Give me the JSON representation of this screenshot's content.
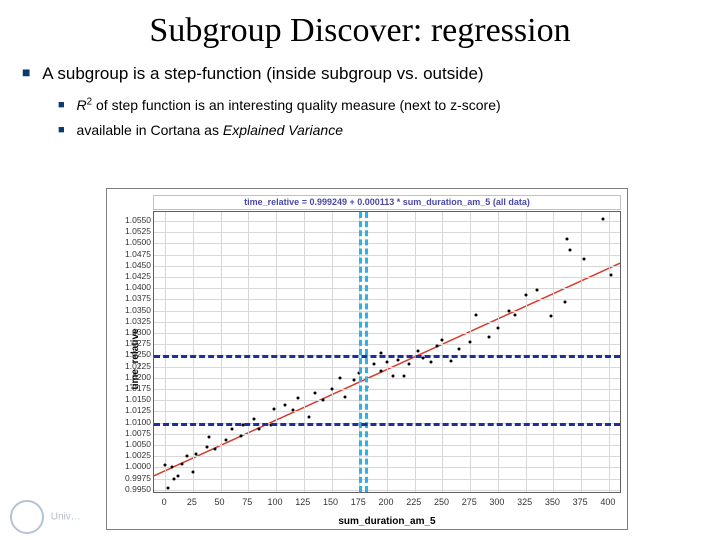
{
  "title": "Subgroup Discover: regression",
  "bullets": {
    "main": "A subgroup is a step-function (inside subgroup vs. outside)",
    "sub1": {
      "r": "R",
      "sup": "2",
      "rest": " of step function is an interesting quality measure (next to z-score)"
    },
    "sub2": {
      "pre": "available in Cortana as ",
      "ital": "Explained Variance"
    }
  },
  "footer": "Univ…",
  "chart_data": {
    "type": "scatter",
    "title": "time_relative = 0.999249 + 0.000113 * sum_duration_am_5 (all data)",
    "xlabel": "sum_duration_am_5",
    "ylabel": "time_relative",
    "xlim": [
      -10,
      410
    ],
    "ylim": [
      0.9945,
      1.057
    ],
    "xticks": [
      0,
      25,
      50,
      75,
      100,
      125,
      150,
      175,
      200,
      225,
      250,
      275,
      300,
      325,
      350,
      375,
      400
    ],
    "yticks": [
      0.995,
      0.9975,
      1.0,
      1.0025,
      1.005,
      1.0075,
      1.01,
      1.0125,
      1.015,
      1.0175,
      1.02,
      1.0225,
      1.025,
      1.0275,
      1.03,
      1.0325,
      1.035,
      1.0375,
      1.04,
      1.0425,
      1.045,
      1.0475,
      1.05,
      1.0525,
      1.055
    ],
    "regression": {
      "intercept": 0.999249,
      "slope": 0.000113
    },
    "v_dashes_x": [
      175,
      180
    ],
    "h_dashes_y": [
      1.01,
      1.025
    ],
    "points": [
      [
        3,
        0.9953
      ],
      [
        8,
        0.9975
      ],
      [
        0,
        1.0005
      ],
      [
        6,
        1.0
      ],
      [
        12,
        0.998
      ],
      [
        15,
        1.0008
      ],
      [
        20,
        1.0025
      ],
      [
        28,
        1.003
      ],
      [
        25,
        0.999
      ],
      [
        40,
        1.0068
      ],
      [
        38,
        1.0045
      ],
      [
        45,
        1.004
      ],
      [
        55,
        1.006
      ],
      [
        60,
        1.0085
      ],
      [
        70,
        1.0095
      ],
      [
        68,
        1.007
      ],
      [
        80,
        1.0108
      ],
      [
        85,
        1.0085
      ],
      [
        95,
        1.0095
      ],
      [
        98,
        1.013
      ],
      [
        108,
        1.014
      ],
      [
        115,
        1.0128
      ],
      [
        120,
        1.0155
      ],
      [
        130,
        1.0112
      ],
      [
        135,
        1.0165
      ],
      [
        142,
        1.015
      ],
      [
        150,
        1.0175
      ],
      [
        158,
        1.02
      ],
      [
        162,
        1.0158
      ],
      [
        170,
        1.0195
      ],
      [
        175,
        1.021
      ],
      [
        182,
        1.018
      ],
      [
        188,
        1.023
      ],
      [
        195,
        1.0215
      ],
      [
        200,
        1.0235
      ],
      [
        195,
        1.0255
      ],
      [
        205,
        1.0205
      ],
      [
        215,
        1.0205
      ],
      [
        210,
        1.024
      ],
      [
        220,
        1.023
      ],
      [
        232,
        1.0245
      ],
      [
        228,
        1.026
      ],
      [
        240,
        1.0235
      ],
      [
        245,
        1.027
      ],
      [
        250,
        1.0285
      ],
      [
        258,
        1.0238
      ],
      [
        265,
        1.0265
      ],
      [
        275,
        1.028
      ],
      [
        280,
        1.034
      ],
      [
        292,
        1.029
      ],
      [
        300,
        1.031
      ],
      [
        310,
        1.035
      ],
      [
        315,
        1.034
      ],
      [
        325,
        1.0385
      ],
      [
        335,
        1.0395
      ],
      [
        348,
        1.0338
      ],
      [
        360,
        1.037
      ],
      [
        362,
        1.051
      ],
      [
        365,
        1.0485
      ],
      [
        378,
        1.0465
      ],
      [
        395,
        1.0555
      ],
      [
        402,
        1.043
      ]
    ]
  }
}
